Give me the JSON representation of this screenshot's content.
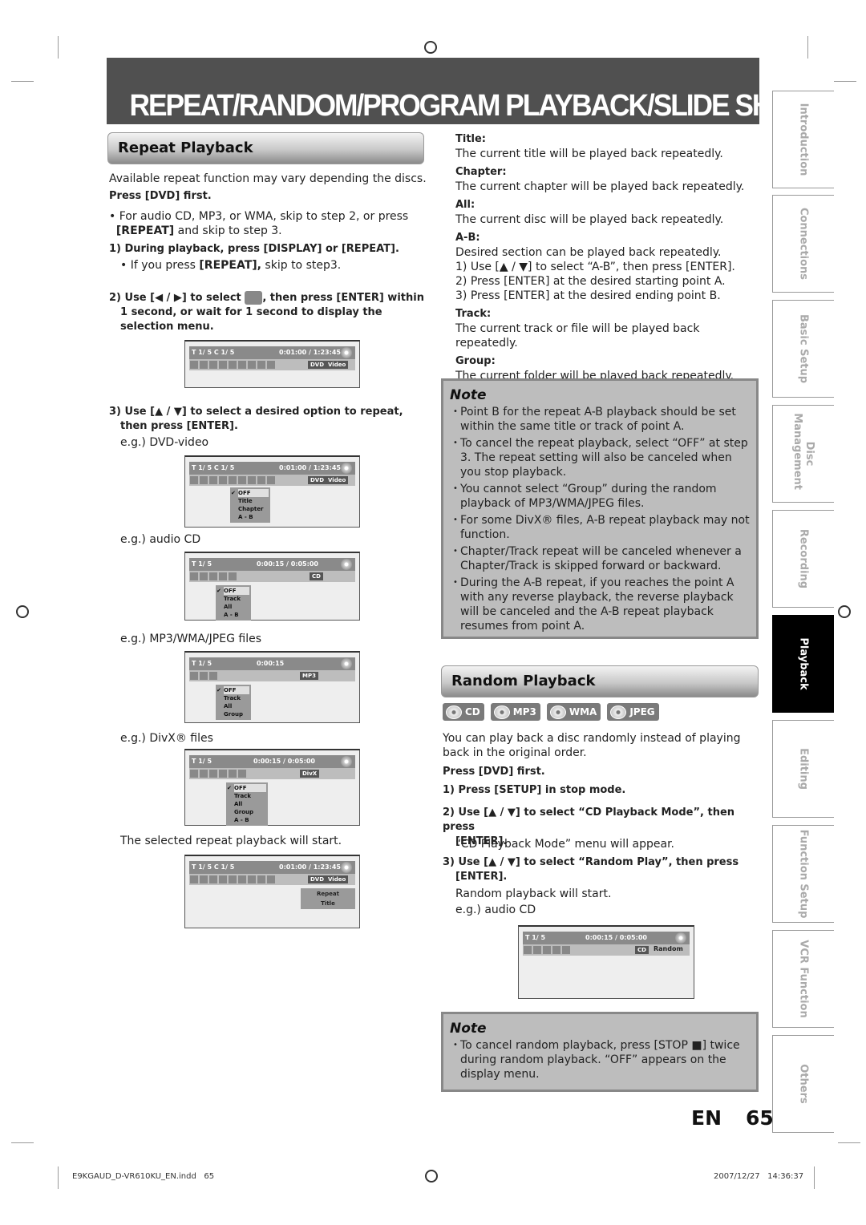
{
  "page_title": "REPEAT/RANDOM/PROGRAM PLAYBACK/SLIDE SHOW",
  "repeat": {
    "heading": "Repeat Playback",
    "intro": "Available repeat function may vary depending the discs.",
    "press_first": "Press [DVD] first.",
    "bullet_pre": "For audio CD, MP3, or WMA, skip to step 2, or press ",
    "bullet_key": "[REPEAT]",
    "bullet_post": " and skip to step 3.",
    "step1": "1) During playback, press [DISPLAY] or [REPEAT].",
    "step1_sub_pre": "If you press ",
    "step1_sub_key": "[REPEAT],",
    "step1_sub_post": " skip to step3.",
    "step2a": "2) Use [◀ / ▶] to select",
    "step2b": ", then press [ENTER] within",
    "step2c": "1 second, or wait for 1 second to display the",
    "step2d": "selection menu.",
    "step3a": "3) Use [▲ / ▼] to select a desired option to repeat,",
    "step3b": "then press [ENTER].",
    "eg_dvd": "e.g.) DVD-video",
    "eg_cd": "e.g.) audio CD",
    "eg_mp3": "e.g.) MP3/WMA/JPEG files",
    "eg_divx": "e.g.) DivX® files",
    "will_start": "The selected repeat playback will start."
  },
  "osd": {
    "dvd_row": "T  1/ 5  C  1/ 5",
    "dvd_time": "0:01:00 / 1:23:45",
    "cd_row": "T  1/ 5",
    "cd_time": "0:00:15 / 0:05:00",
    "mp3_time": "0:00:15",
    "chip_dvd": "DVD",
    "chip_video": "Video",
    "chip_cd": "CD",
    "chip_mp3": "MP3",
    "chip_divx": "DivX",
    "menu_dvd": [
      "OFF",
      "Title",
      "Chapter",
      "A - B"
    ],
    "menu_cd": [
      "OFF",
      "Track",
      "All",
      "A - B"
    ],
    "menu_mp3": [
      "OFF",
      "Track",
      "All",
      "Group"
    ],
    "menu_divx": [
      "OFF",
      "Track",
      "All",
      "Group",
      "A - B"
    ],
    "repeat_label": "Repeat",
    "repeat_value": "Title",
    "random_label": "Random"
  },
  "options": [
    {
      "label": "Title:",
      "desc": "The current title will be played back repeatedly."
    },
    {
      "label": "Chapter:",
      "desc": "The current chapter will be played back repeatedly."
    },
    {
      "label": "All:",
      "desc": "The current disc will be played back repeatedly."
    },
    {
      "label": "A-B:",
      "desc": "Desired section can be played back repeatedly."
    },
    {
      "label": "Track:",
      "desc": "The current track or file will be played back repeatedly."
    },
    {
      "label": "Group:",
      "desc": "The current folder will be played back repeatedly."
    }
  ],
  "ab_steps": [
    "1) Use [▲ / ▼] to select “A-B”, then press [ENTER].",
    "2) Press [ENTER] at the desired starting point A.",
    "3) Press [ENTER] at the desired ending point B."
  ],
  "note1": {
    "heading": "Note",
    "items": [
      "Point B for the repeat A-B playback should be set within the same title or track of point A.",
      "To cancel the repeat playback, select “OFF” at step 3. The repeat setting will also be canceled when you stop playback.",
      "You cannot select “Group” during the random playback of MP3/WMA/JPEG files.",
      "For some DivX® files, A-B repeat playback may not function.",
      "Chapter/Track repeat will be canceled whenever a Chapter/Track is skipped forward or backward.",
      "During the A-B repeat, if you reaches the point A with any reverse playback, the reverse playback will be canceled and the A-B repeat playback resumes from point A."
    ]
  },
  "random": {
    "heading": "Random Playback",
    "formats": [
      "CD",
      "MP3",
      "WMA",
      "JPEG"
    ],
    "intro": "You can play back a disc randomly instead of playing back in the original order.",
    "press_first": "Press [DVD] first.",
    "step1": "1) Press [SETUP] in stop mode.",
    "step2a": "2) Use [▲ / ▼] to select “CD Playback Mode”, then press",
    "step2b": "[ENTER].",
    "step2_sub": "“CD Playback Mode” menu will appear.",
    "step3a": "3) Use [▲ / ▼] to select “Random Play”, then press",
    "step3b": "[ENTER].",
    "step3_sub": "Random playback will start.",
    "eg": "e.g.) audio CD"
  },
  "note2": {
    "heading": "Note",
    "items": [
      "To cancel random playback, press [STOP ■] twice during random playback. “OFF” appears on the display menu."
    ]
  },
  "tabs": [
    "Introduction",
    "Connections",
    "Basic Setup",
    "Disc Management",
    "Recording",
    "Playback",
    "Editing",
    "Function Setup",
    "VCR Function",
    "Others"
  ],
  "page_num": {
    "lang": "EN",
    "num": "65"
  },
  "footer": {
    "file": "E9KGAUD_D-VR610KU_EN.indd   65",
    "date": "2007/12/27   14:36:37"
  }
}
